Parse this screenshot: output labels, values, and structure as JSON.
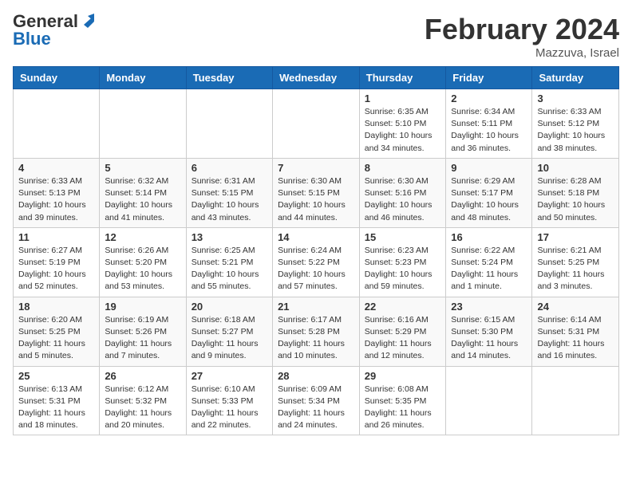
{
  "header": {
    "logo_general": "General",
    "logo_blue": "Blue",
    "month_title": "February 2024",
    "location": "Mazzuva, Israel"
  },
  "weekdays": [
    "Sunday",
    "Monday",
    "Tuesday",
    "Wednesday",
    "Thursday",
    "Friday",
    "Saturday"
  ],
  "weeks": [
    [
      {
        "day": "",
        "info": ""
      },
      {
        "day": "",
        "info": ""
      },
      {
        "day": "",
        "info": ""
      },
      {
        "day": "",
        "info": ""
      },
      {
        "day": "1",
        "info": "Sunrise: 6:35 AM\nSunset: 5:10 PM\nDaylight: 10 hours\nand 34 minutes."
      },
      {
        "day": "2",
        "info": "Sunrise: 6:34 AM\nSunset: 5:11 PM\nDaylight: 10 hours\nand 36 minutes."
      },
      {
        "day": "3",
        "info": "Sunrise: 6:33 AM\nSunset: 5:12 PM\nDaylight: 10 hours\nand 38 minutes."
      }
    ],
    [
      {
        "day": "4",
        "info": "Sunrise: 6:33 AM\nSunset: 5:13 PM\nDaylight: 10 hours\nand 39 minutes."
      },
      {
        "day": "5",
        "info": "Sunrise: 6:32 AM\nSunset: 5:14 PM\nDaylight: 10 hours\nand 41 minutes."
      },
      {
        "day": "6",
        "info": "Sunrise: 6:31 AM\nSunset: 5:15 PM\nDaylight: 10 hours\nand 43 minutes."
      },
      {
        "day": "7",
        "info": "Sunrise: 6:30 AM\nSunset: 5:15 PM\nDaylight: 10 hours\nand 44 minutes."
      },
      {
        "day": "8",
        "info": "Sunrise: 6:30 AM\nSunset: 5:16 PM\nDaylight: 10 hours\nand 46 minutes."
      },
      {
        "day": "9",
        "info": "Sunrise: 6:29 AM\nSunset: 5:17 PM\nDaylight: 10 hours\nand 48 minutes."
      },
      {
        "day": "10",
        "info": "Sunrise: 6:28 AM\nSunset: 5:18 PM\nDaylight: 10 hours\nand 50 minutes."
      }
    ],
    [
      {
        "day": "11",
        "info": "Sunrise: 6:27 AM\nSunset: 5:19 PM\nDaylight: 10 hours\nand 52 minutes."
      },
      {
        "day": "12",
        "info": "Sunrise: 6:26 AM\nSunset: 5:20 PM\nDaylight: 10 hours\nand 53 minutes."
      },
      {
        "day": "13",
        "info": "Sunrise: 6:25 AM\nSunset: 5:21 PM\nDaylight: 10 hours\nand 55 minutes."
      },
      {
        "day": "14",
        "info": "Sunrise: 6:24 AM\nSunset: 5:22 PM\nDaylight: 10 hours\nand 57 minutes."
      },
      {
        "day": "15",
        "info": "Sunrise: 6:23 AM\nSunset: 5:23 PM\nDaylight: 10 hours\nand 59 minutes."
      },
      {
        "day": "16",
        "info": "Sunrise: 6:22 AM\nSunset: 5:24 PM\nDaylight: 11 hours\nand 1 minute."
      },
      {
        "day": "17",
        "info": "Sunrise: 6:21 AM\nSunset: 5:25 PM\nDaylight: 11 hours\nand 3 minutes."
      }
    ],
    [
      {
        "day": "18",
        "info": "Sunrise: 6:20 AM\nSunset: 5:25 PM\nDaylight: 11 hours\nand 5 minutes."
      },
      {
        "day": "19",
        "info": "Sunrise: 6:19 AM\nSunset: 5:26 PM\nDaylight: 11 hours\nand 7 minutes."
      },
      {
        "day": "20",
        "info": "Sunrise: 6:18 AM\nSunset: 5:27 PM\nDaylight: 11 hours\nand 9 minutes."
      },
      {
        "day": "21",
        "info": "Sunrise: 6:17 AM\nSunset: 5:28 PM\nDaylight: 11 hours\nand 10 minutes."
      },
      {
        "day": "22",
        "info": "Sunrise: 6:16 AM\nSunset: 5:29 PM\nDaylight: 11 hours\nand 12 minutes."
      },
      {
        "day": "23",
        "info": "Sunrise: 6:15 AM\nSunset: 5:30 PM\nDaylight: 11 hours\nand 14 minutes."
      },
      {
        "day": "24",
        "info": "Sunrise: 6:14 AM\nSunset: 5:31 PM\nDaylight: 11 hours\nand 16 minutes."
      }
    ],
    [
      {
        "day": "25",
        "info": "Sunrise: 6:13 AM\nSunset: 5:31 PM\nDaylight: 11 hours\nand 18 minutes."
      },
      {
        "day": "26",
        "info": "Sunrise: 6:12 AM\nSunset: 5:32 PM\nDaylight: 11 hours\nand 20 minutes."
      },
      {
        "day": "27",
        "info": "Sunrise: 6:10 AM\nSunset: 5:33 PM\nDaylight: 11 hours\nand 22 minutes."
      },
      {
        "day": "28",
        "info": "Sunrise: 6:09 AM\nSunset: 5:34 PM\nDaylight: 11 hours\nand 24 minutes."
      },
      {
        "day": "29",
        "info": "Sunrise: 6:08 AM\nSunset: 5:35 PM\nDaylight: 11 hours\nand 26 minutes."
      },
      {
        "day": "",
        "info": ""
      },
      {
        "day": "",
        "info": ""
      }
    ]
  ]
}
